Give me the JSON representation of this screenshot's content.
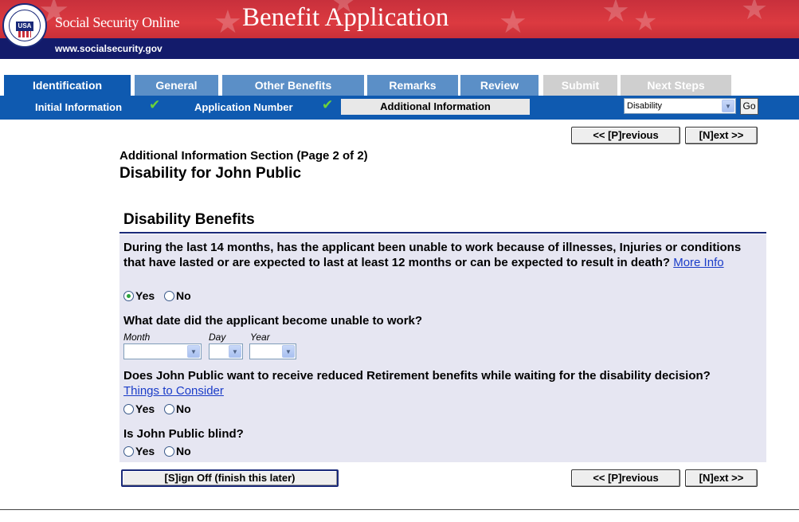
{
  "header": {
    "site_name": "Social Security Online",
    "app_title": "Benefit Application",
    "url": "www.socialsecurity.gov",
    "seal_text": "USA",
    "colors": {
      "banner_red": "#d0303a",
      "navy": "#131b6b",
      "tab_blue": "#0f5ab0"
    }
  },
  "tabs": [
    {
      "label": "Identification",
      "state": "active"
    },
    {
      "label": "General",
      "state": "enabled"
    },
    {
      "label": "Other Benefits",
      "state": "enabled"
    },
    {
      "label": "Remarks",
      "state": "enabled"
    },
    {
      "label": "Review",
      "state": "enabled"
    },
    {
      "label": "Submit",
      "state": "disabled"
    },
    {
      "label": "Next Steps",
      "state": "disabled"
    }
  ],
  "subnav": {
    "items": [
      {
        "label": "Initial Information",
        "completed": true
      },
      {
        "label": "Application Number",
        "completed": true
      },
      {
        "label": "Additional Information",
        "current": true
      }
    ],
    "check_icon": "checkmark-icon",
    "jump_select_value": "Disability",
    "go_label": "Go"
  },
  "nav_buttons": {
    "previous": "<< [P]revious",
    "next": "[N]ext >>",
    "sign_off": "[S]ign Off (finish this later)"
  },
  "page": {
    "section_label": "Additional Information Section (Page 2 of 2)",
    "heading": "Disability for John Public"
  },
  "panel": {
    "title": "Disability Benefits",
    "q1": {
      "text": "During the last 14 months, has the applicant been unable to work because of illnesses, Injuries or conditions that have lasted or are expected to last at least 12 months or can be expected to result in death?",
      "link": "More Info",
      "answer": "Yes"
    },
    "q2": {
      "text": "What date did the applicant become unable to work?",
      "month_label": "Month",
      "day_label": "Day",
      "year_label": "Year",
      "month_value": "",
      "day_value": "",
      "year_value": ""
    },
    "q3": {
      "text": "Does John Public want to receive reduced Retirement benefits while waiting for the disability decision?",
      "link": "Things to Consider",
      "answer": ""
    },
    "q4": {
      "text": "Is John Public blind?",
      "answer": ""
    },
    "yes_label": "Yes",
    "no_label": "No"
  }
}
